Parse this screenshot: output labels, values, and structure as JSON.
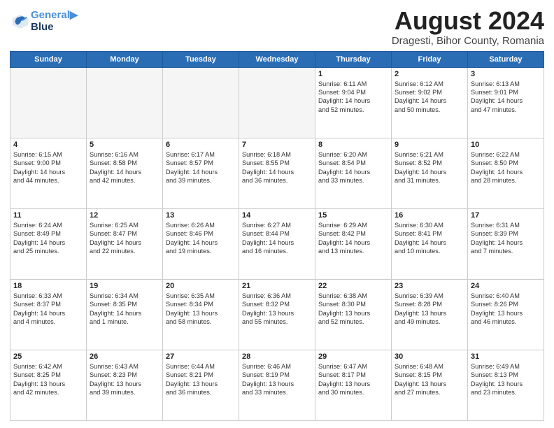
{
  "header": {
    "logo_line1": "General",
    "logo_line2": "Blue",
    "month_title": "August 2024",
    "subtitle": "Dragesti, Bihor County, Romania"
  },
  "weekdays": [
    "Sunday",
    "Monday",
    "Tuesday",
    "Wednesday",
    "Thursday",
    "Friday",
    "Saturday"
  ],
  "weeks": [
    [
      {
        "day": "",
        "info": ""
      },
      {
        "day": "",
        "info": ""
      },
      {
        "day": "",
        "info": ""
      },
      {
        "day": "",
        "info": ""
      },
      {
        "day": "1",
        "info": "Sunrise: 6:11 AM\nSunset: 9:04 PM\nDaylight: 14 hours\nand 52 minutes."
      },
      {
        "day": "2",
        "info": "Sunrise: 6:12 AM\nSunset: 9:02 PM\nDaylight: 14 hours\nand 50 minutes."
      },
      {
        "day": "3",
        "info": "Sunrise: 6:13 AM\nSunset: 9:01 PM\nDaylight: 14 hours\nand 47 minutes."
      }
    ],
    [
      {
        "day": "4",
        "info": "Sunrise: 6:15 AM\nSunset: 9:00 PM\nDaylight: 14 hours\nand 44 minutes."
      },
      {
        "day": "5",
        "info": "Sunrise: 6:16 AM\nSunset: 8:58 PM\nDaylight: 14 hours\nand 42 minutes."
      },
      {
        "day": "6",
        "info": "Sunrise: 6:17 AM\nSunset: 8:57 PM\nDaylight: 14 hours\nand 39 minutes."
      },
      {
        "day": "7",
        "info": "Sunrise: 6:18 AM\nSunset: 8:55 PM\nDaylight: 14 hours\nand 36 minutes."
      },
      {
        "day": "8",
        "info": "Sunrise: 6:20 AM\nSunset: 8:54 PM\nDaylight: 14 hours\nand 33 minutes."
      },
      {
        "day": "9",
        "info": "Sunrise: 6:21 AM\nSunset: 8:52 PM\nDaylight: 14 hours\nand 31 minutes."
      },
      {
        "day": "10",
        "info": "Sunrise: 6:22 AM\nSunset: 8:50 PM\nDaylight: 14 hours\nand 28 minutes."
      }
    ],
    [
      {
        "day": "11",
        "info": "Sunrise: 6:24 AM\nSunset: 8:49 PM\nDaylight: 14 hours\nand 25 minutes."
      },
      {
        "day": "12",
        "info": "Sunrise: 6:25 AM\nSunset: 8:47 PM\nDaylight: 14 hours\nand 22 minutes."
      },
      {
        "day": "13",
        "info": "Sunrise: 6:26 AM\nSunset: 8:46 PM\nDaylight: 14 hours\nand 19 minutes."
      },
      {
        "day": "14",
        "info": "Sunrise: 6:27 AM\nSunset: 8:44 PM\nDaylight: 14 hours\nand 16 minutes."
      },
      {
        "day": "15",
        "info": "Sunrise: 6:29 AM\nSunset: 8:42 PM\nDaylight: 14 hours\nand 13 minutes."
      },
      {
        "day": "16",
        "info": "Sunrise: 6:30 AM\nSunset: 8:41 PM\nDaylight: 14 hours\nand 10 minutes."
      },
      {
        "day": "17",
        "info": "Sunrise: 6:31 AM\nSunset: 8:39 PM\nDaylight: 14 hours\nand 7 minutes."
      }
    ],
    [
      {
        "day": "18",
        "info": "Sunrise: 6:33 AM\nSunset: 8:37 PM\nDaylight: 14 hours\nand 4 minutes."
      },
      {
        "day": "19",
        "info": "Sunrise: 6:34 AM\nSunset: 8:35 PM\nDaylight: 14 hours\nand 1 minute."
      },
      {
        "day": "20",
        "info": "Sunrise: 6:35 AM\nSunset: 8:34 PM\nDaylight: 13 hours\nand 58 minutes."
      },
      {
        "day": "21",
        "info": "Sunrise: 6:36 AM\nSunset: 8:32 PM\nDaylight: 13 hours\nand 55 minutes."
      },
      {
        "day": "22",
        "info": "Sunrise: 6:38 AM\nSunset: 8:30 PM\nDaylight: 13 hours\nand 52 minutes."
      },
      {
        "day": "23",
        "info": "Sunrise: 6:39 AM\nSunset: 8:28 PM\nDaylight: 13 hours\nand 49 minutes."
      },
      {
        "day": "24",
        "info": "Sunrise: 6:40 AM\nSunset: 8:26 PM\nDaylight: 13 hours\nand 46 minutes."
      }
    ],
    [
      {
        "day": "25",
        "info": "Sunrise: 6:42 AM\nSunset: 8:25 PM\nDaylight: 13 hours\nand 42 minutes."
      },
      {
        "day": "26",
        "info": "Sunrise: 6:43 AM\nSunset: 8:23 PM\nDaylight: 13 hours\nand 39 minutes."
      },
      {
        "day": "27",
        "info": "Sunrise: 6:44 AM\nSunset: 8:21 PM\nDaylight: 13 hours\nand 36 minutes."
      },
      {
        "day": "28",
        "info": "Sunrise: 6:46 AM\nSunset: 8:19 PM\nDaylight: 13 hours\nand 33 minutes."
      },
      {
        "day": "29",
        "info": "Sunrise: 6:47 AM\nSunset: 8:17 PM\nDaylight: 13 hours\nand 30 minutes."
      },
      {
        "day": "30",
        "info": "Sunrise: 6:48 AM\nSunset: 8:15 PM\nDaylight: 13 hours\nand 27 minutes."
      },
      {
        "day": "31",
        "info": "Sunrise: 6:49 AM\nSunset: 8:13 PM\nDaylight: 13 hours\nand 23 minutes."
      }
    ]
  ]
}
